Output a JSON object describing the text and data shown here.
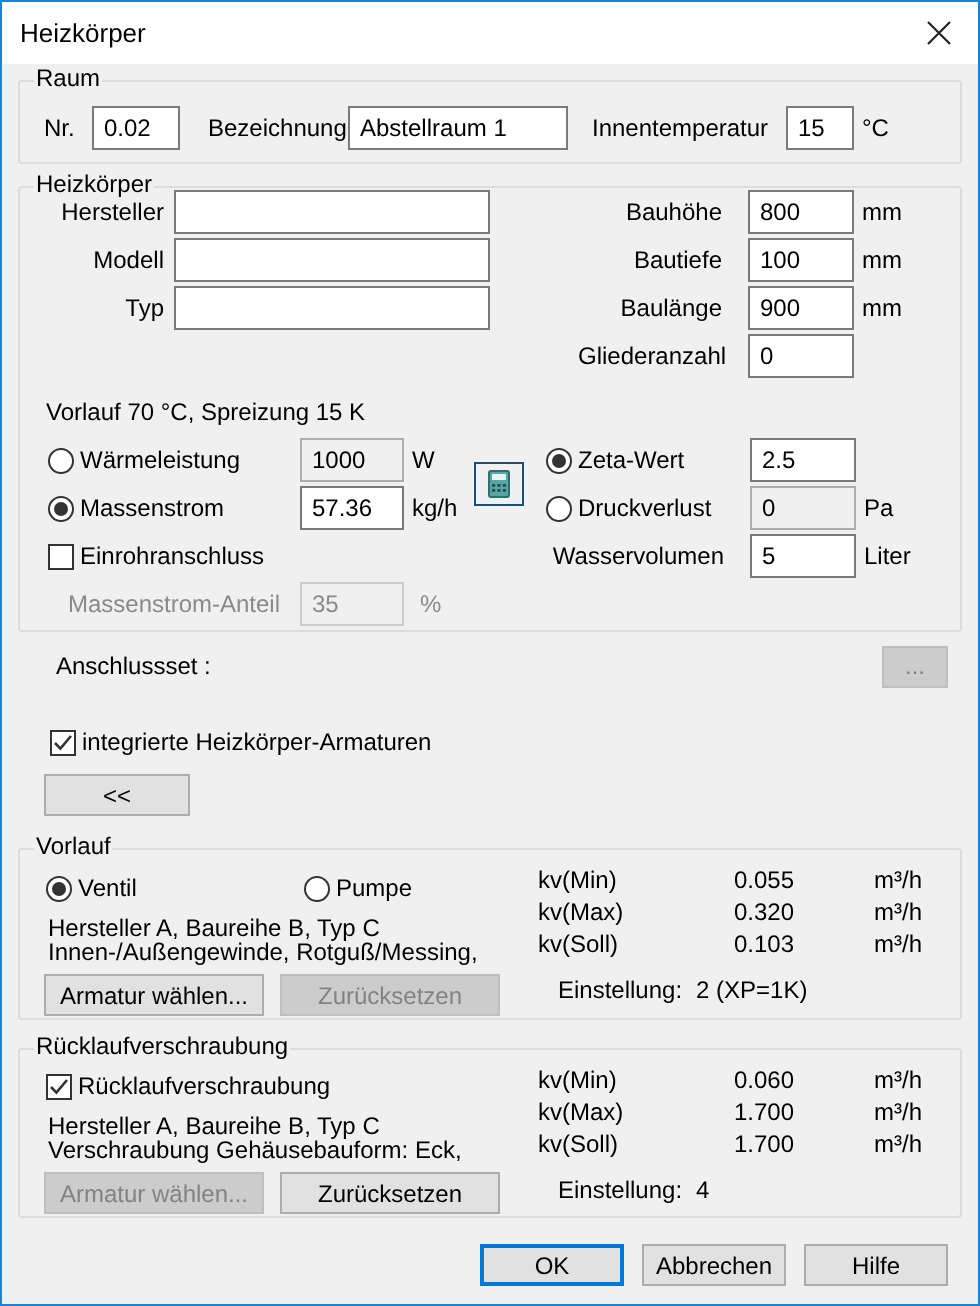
{
  "window": {
    "title": "Heizkörper"
  },
  "raum": {
    "title": "Raum",
    "fields": [
      {
        "label": "Nr.",
        "value": "0.02"
      },
      {
        "label": "Bezeichnung",
        "value": "Abstellraum 1"
      },
      {
        "label": "Innentemperatur",
        "value": "15",
        "unit": "°C"
      }
    ]
  },
  "heizkoerper": {
    "title": "Heizkörper",
    "left_fields": [
      {
        "label": "Hersteller"
      },
      {
        "label": "Modell"
      },
      {
        "label": "Typ"
      }
    ],
    "right_fields": [
      {
        "label": "Bauhöhe",
        "value": "800",
        "unit": "mm"
      },
      {
        "label": "Bautiefe",
        "value": "100",
        "unit": "mm"
      },
      {
        "label": "Baulänge",
        "value": "900",
        "unit": "mm"
      },
      {
        "label": "Gliederanzahl",
        "value": "0"
      }
    ],
    "info": "Vorlauf 70 °C, Spreizung 15 K",
    "mode_options": [
      {
        "label": "Wärmeleistung",
        "selected": false,
        "value": "1000",
        "unit": "W"
      },
      {
        "label": "Massenstrom",
        "selected": true,
        "value": "57.36",
        "unit": "kg/h"
      }
    ],
    "loss_options": [
      {
        "label": "Zeta-Wert",
        "selected": true,
        "value": "2.5"
      },
      {
        "label": "Druckverlust",
        "selected": false,
        "value": "0",
        "unit": "Pa"
      }
    ],
    "wasservolumen": {
      "label": "Wasservolumen",
      "value": "5",
      "unit": "Liter"
    },
    "einrohr": {
      "label": "Einrohranschluss",
      "checked": false
    },
    "massenstrom_anteil": {
      "label": "Massenstrom-Anteil",
      "value": "35",
      "unit": "%",
      "disabled": true
    }
  },
  "anschlussset": {
    "label": "Anschlussset :",
    "button": "...",
    "disabled": true
  },
  "integrierte": {
    "label": "integrierte Heizkörper-Armaturen",
    "checked": true
  },
  "collapse_button": "<<",
  "vorlauf": {
    "title": "Vorlauf",
    "options": [
      {
        "label": "Ventil",
        "selected": true
      },
      {
        "label": "Pumpe",
        "selected": false
      }
    ],
    "description": [
      "Hersteller A, Baureihe B, Typ C",
      "Innen-/Außengewinde, Rotguß/Messing,"
    ],
    "buttons": [
      {
        "label": "Armatur wählen...",
        "disabled": false
      },
      {
        "label": "Zurücksetzen",
        "disabled": true
      }
    ],
    "kv": [
      {
        "label": "kv(Min)",
        "value": "0.055",
        "unit": "m³/h"
      },
      {
        "label": "kv(Max)",
        "value": "0.320",
        "unit": "m³/h"
      },
      {
        "label": "kv(Soll)",
        "value": "0.103",
        "unit": "m³/h"
      }
    ],
    "einstellung": {
      "label": "Einstellung:",
      "value": "2 (XP=1K)"
    }
  },
  "ruecklauf": {
    "title": "Rücklaufverschraubung",
    "checkbox": {
      "label": "Rücklaufverschraubung",
      "checked": true
    },
    "description": [
      "Hersteller A, Baureihe B, Typ C",
      "Verschraubung Gehäusebauform: Eck,"
    ],
    "buttons": [
      {
        "label": "Armatur wählen...",
        "disabled": true
      },
      {
        "label": "Zurücksetzen",
        "disabled": false
      }
    ],
    "kv": [
      {
        "label": "kv(Min)",
        "value": "0.060",
        "unit": "m³/h"
      },
      {
        "label": "kv(Max)",
        "value": "1.700",
        "unit": "m³/h"
      },
      {
        "label": "kv(Soll)",
        "value": "1.700",
        "unit": "m³/h"
      }
    ],
    "einstellung": {
      "label": "Einstellung:",
      "value": "4"
    }
  },
  "buttons": [
    {
      "label": "OK",
      "default": true
    },
    {
      "label": "Abbrechen",
      "default": false
    },
    {
      "label": "Hilfe",
      "default": false
    }
  ]
}
